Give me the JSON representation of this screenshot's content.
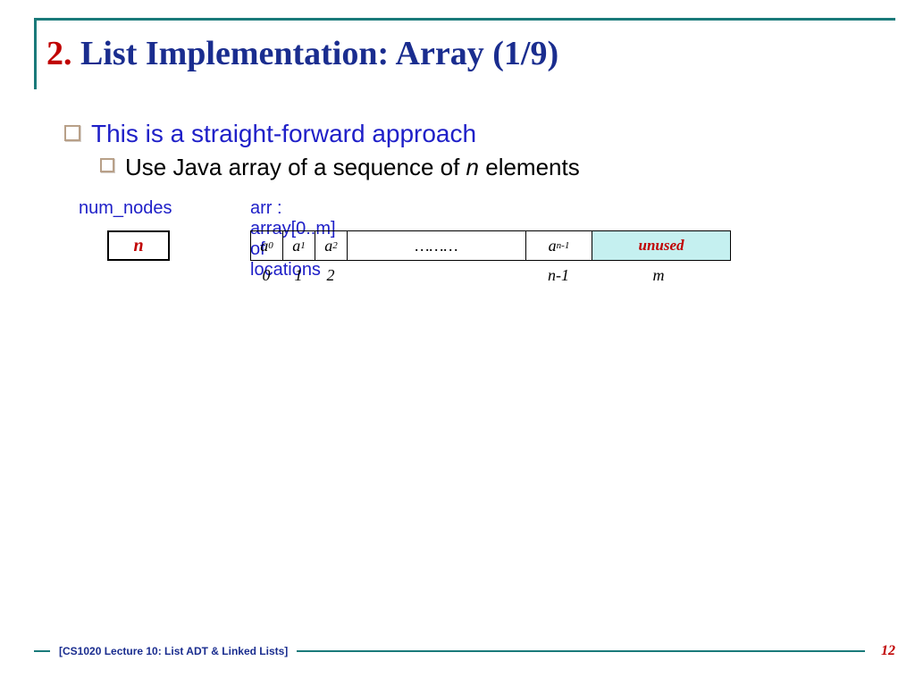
{
  "title": {
    "num": "2.",
    "text": " List Implementation: Array (1/9)"
  },
  "bullets": {
    "b1": "This is a straight-forward approach",
    "b2_pre": "Use Java array of a sequence of ",
    "b2_n": "n",
    "b2_post": " elements"
  },
  "diagram": {
    "num_nodes_label": "num_nodes",
    "arr_label": "arr : array[0..m] of locations",
    "n": "n",
    "cells": {
      "a0": "a",
      "s0": "0",
      "a1": "a",
      "s1": "1",
      "a2": "a",
      "s2": "2",
      "dots": "………",
      "an": "a",
      "sn": "n-1",
      "unused": "unused"
    },
    "idx": {
      "i0": "0",
      "i1": "1",
      "i2": "2",
      "in": "n-1",
      "im": "m"
    }
  },
  "footer": {
    "text": "[CS1020 Lecture 10: List ADT & Linked Lists]",
    "page": "12"
  }
}
